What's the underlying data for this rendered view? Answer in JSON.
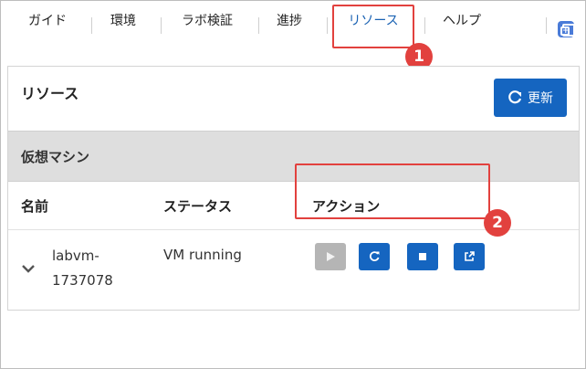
{
  "tabs": [
    {
      "label": "ガイド"
    },
    {
      "label": "環境"
    },
    {
      "label": "ラボ検証"
    },
    {
      "label": "進捗"
    },
    {
      "label": "リソース"
    },
    {
      "label": "ヘルプ"
    }
  ],
  "active_tab": "リソース",
  "badges": {
    "first": "1",
    "second": "2"
  },
  "panel": {
    "title": "リソース",
    "refresh_label": "更新"
  },
  "section": {
    "title": "仮想マシン"
  },
  "table": {
    "headers": [
      "名前",
      "ステータス",
      "アクション"
    ],
    "rows": [
      {
        "name_line1": "labvm-",
        "name_line2": "1737078",
        "status": "VM running",
        "actions": [
          "play-icon",
          "restart-icon",
          "stop-icon",
          "open-external-icon"
        ]
      }
    ]
  },
  "colors": {
    "accent": "#1565c0",
    "highlight": "#e2413e",
    "active_tab_text": "#1a62b3",
    "disabled_button": "#b5b5b5",
    "section_bar": "#dedede"
  }
}
